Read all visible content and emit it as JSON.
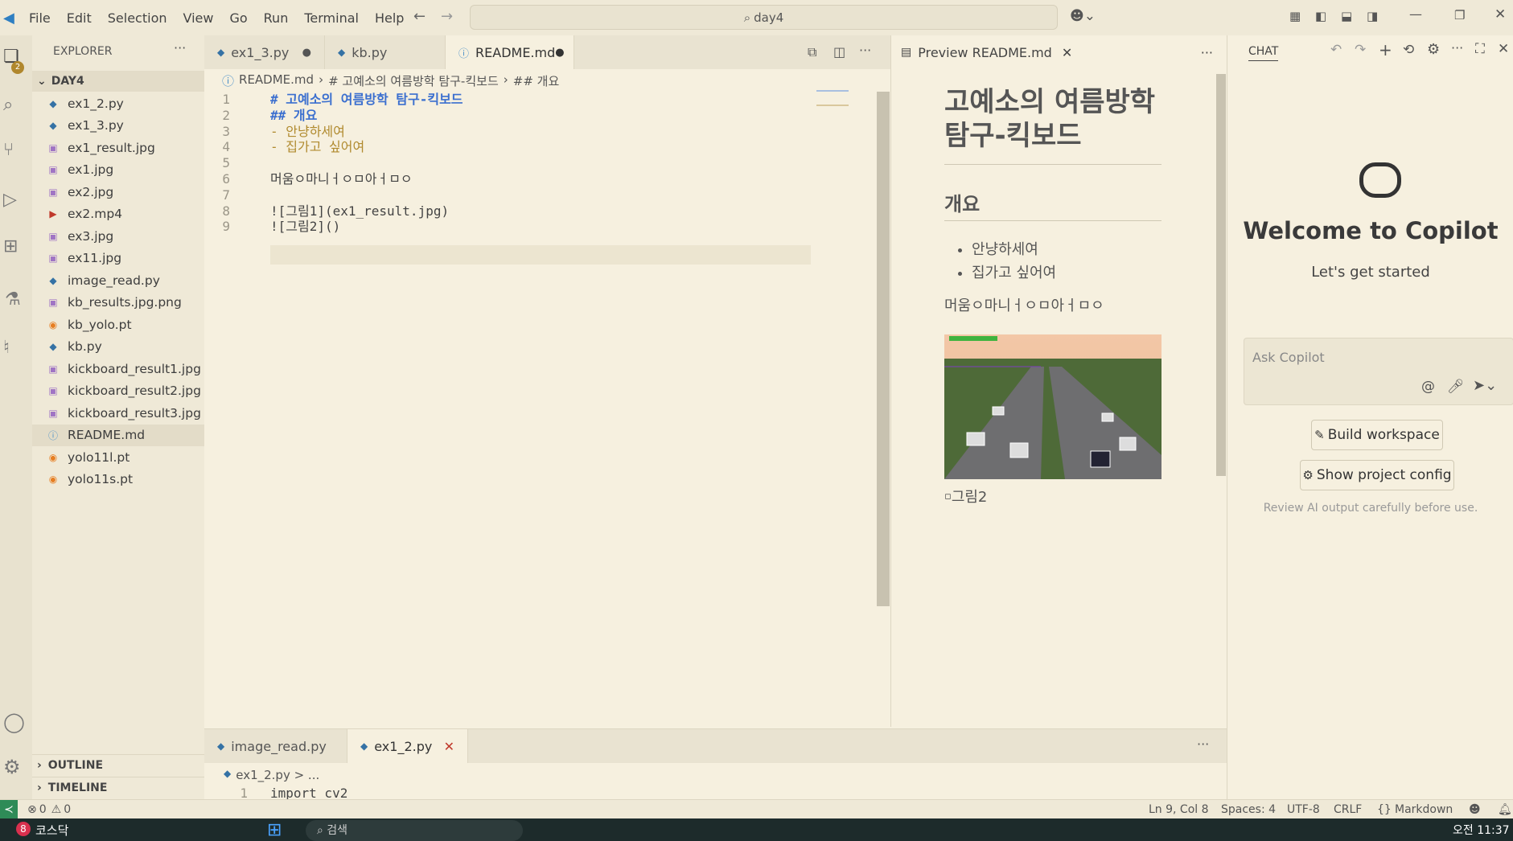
{
  "menu": [
    "File",
    "Edit",
    "Selection",
    "View",
    "Go",
    "Run",
    "Terminal",
    "Help"
  ],
  "search": {
    "text": "day4"
  },
  "activity_badge": "2",
  "explorer": {
    "title": "EXPLORER",
    "folder": "DAY4",
    "files": [
      {
        "name": "ex1_2.py",
        "icon": "python-icon",
        "color": "#3572a5"
      },
      {
        "name": "ex1_3.py",
        "icon": "python-icon",
        "color": "#3572a5"
      },
      {
        "name": "ex1_result.jpg",
        "icon": "image-icon",
        "color": "#a074c4"
      },
      {
        "name": "ex1.jpg",
        "icon": "image-icon",
        "color": "#a074c4"
      },
      {
        "name": "ex2.jpg",
        "icon": "image-icon",
        "color": "#a074c4"
      },
      {
        "name": "ex2.mp4",
        "icon": "video-icon",
        "color": "#c0392b"
      },
      {
        "name": "ex3.jpg",
        "icon": "image-icon",
        "color": "#a074c4"
      },
      {
        "name": "ex11.jpg",
        "icon": "image-icon",
        "color": "#a074c4"
      },
      {
        "name": "image_read.py",
        "icon": "python-icon",
        "color": "#3572a5"
      },
      {
        "name": "kb_results.jpg.png",
        "icon": "image-icon",
        "color": "#a074c4"
      },
      {
        "name": "kb_yolo.pt",
        "icon": "rss-icon",
        "color": "#e67e22"
      },
      {
        "name": "kb.py",
        "icon": "python-icon",
        "color": "#3572a5"
      },
      {
        "name": "kickboard_result1.jpg",
        "icon": "image-icon",
        "color": "#a074c4"
      },
      {
        "name": "kickboard_result2.jpg",
        "icon": "image-icon",
        "color": "#a074c4"
      },
      {
        "name": "kickboard_result3.jpg",
        "icon": "image-icon",
        "color": "#a074c4"
      },
      {
        "name": "README.md",
        "icon": "info-icon",
        "color": "#4a90c9"
      },
      {
        "name": "yolo11l.pt",
        "icon": "rss-icon",
        "color": "#e67e22"
      },
      {
        "name": "yolo11s.pt",
        "icon": "rss-icon",
        "color": "#e67e22"
      }
    ],
    "outline": "OUTLINE",
    "timeline": "TIMELINE"
  },
  "tabs": [
    {
      "label": "ex1_3.py",
      "dirty": "●"
    },
    {
      "label": "kb.py",
      "dirty": ""
    },
    {
      "label": "README.md",
      "dirty": "●"
    }
  ],
  "breadcrumb": {
    "file": "README.md",
    "h1": "# 고예소의 여름방학 탐구-킥보드",
    "h2": "## 개요"
  },
  "code_lines": [
    {
      "n": "1",
      "t": "# 고예소의 여름방학 탐구-킥보드",
      "c": "#3b6fcf",
      "b": true
    },
    {
      "n": "2",
      "t": "## 개요",
      "c": "#3b6fcf",
      "b": true
    },
    {
      "n": "3",
      "t": "- 안냥하세여",
      "c": "#b08a2e",
      "b": false
    },
    {
      "n": "4",
      "t": "- 집가고 싶어여",
      "c": "#b08a2e",
      "b": false
    },
    {
      "n": "5",
      "t": "",
      "c": "#333",
      "b": false
    },
    {
      "n": "6",
      "t": "머움ㅇ마니ㅓㅇㅁ아ㅓㅁㅇ",
      "c": "#444",
      "b": false
    },
    {
      "n": "7",
      "t": "",
      "c": "#444",
      "b": false
    },
    {
      "n": "8",
      "t": "![그림1](ex1_result.jpg)",
      "c": "#444",
      "b": false
    },
    {
      "n": "9",
      "t": "![그림2]()",
      "c": "#444",
      "b": false
    }
  ],
  "preview": {
    "tab": "Preview README.md",
    "h1": "고예소의 여름방학 탐구-킥보드",
    "h2": "개요",
    "bullets": [
      "안냥하세여",
      "집가고 싶어여"
    ],
    "para": "머움ㅇ마니ㅓㅇㅁ아ㅓㅁㅇ",
    "broken_img": "그림2"
  },
  "chat": {
    "label": "CHAT",
    "welcome": "Welcome to Copilot",
    "sub": "Let's get started",
    "placeholder": "Ask Copilot",
    "build": "Build workspace",
    "config": "Show project config",
    "note": "Review AI output carefully before use."
  },
  "panel": {
    "tabs": [
      "image_read.py",
      "ex1_2.py"
    ],
    "breadcrumb": "ex1_2.py > ...",
    "line_n": "1",
    "line_t": "import cv2"
  },
  "status": {
    "errors": "0",
    "warnings": "0",
    "pos": "Ln 9, Col 8",
    "spaces": "Spaces: 4",
    "enc": "UTF-8",
    "eol": "CRLF",
    "lang": "Markdown"
  },
  "taskbar": {
    "badge": "8",
    "app": "코스닥",
    "search": "검색",
    "time": "오전 11:37"
  }
}
